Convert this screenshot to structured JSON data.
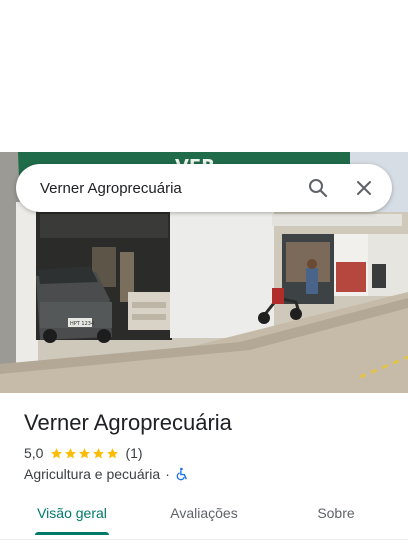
{
  "search": {
    "value": "Verner Agroprecuária"
  },
  "place": {
    "title": "Verner Agroprecuária",
    "rating": "5,0",
    "stars_filled": 5,
    "review_count": "(1)",
    "category": "Agricultura e pecuária",
    "separator": "·",
    "accessibility_icon": "wheelchair-accessible-icon"
  },
  "photo": {
    "sign_text": "VER",
    "plate_text": "HPT 1234"
  },
  "tabs": [
    {
      "label": "Visão geral",
      "selected": true
    },
    {
      "label": "Avaliações",
      "selected": false
    },
    {
      "label": "Sobre",
      "selected": false
    }
  ],
  "colors": {
    "accent": "#00796b",
    "star": "#fbbc04",
    "accessibility": "#1a73e8"
  }
}
